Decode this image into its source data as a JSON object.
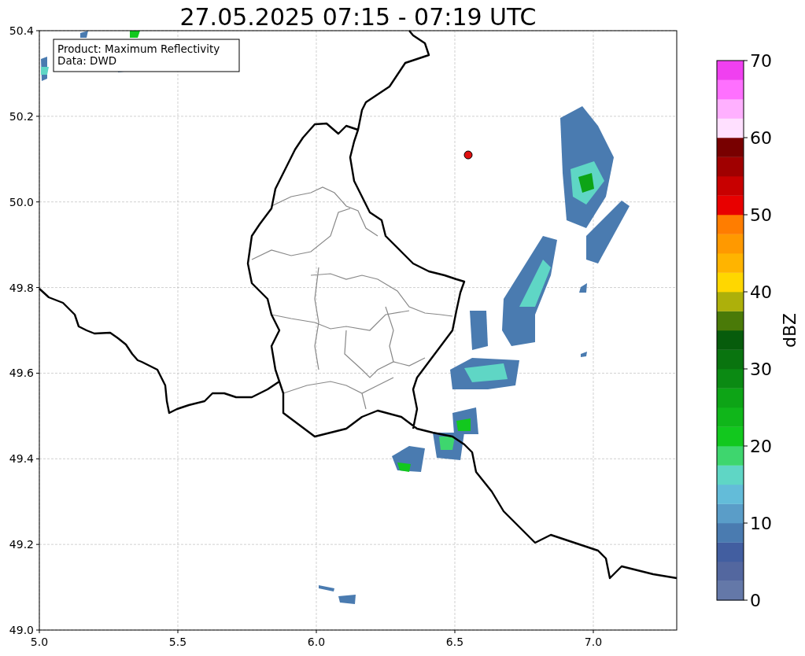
{
  "title": "27.05.2025 07:15 - 07:19 UTC",
  "info_box": {
    "lines": [
      "Product: Maximum Reflectivity",
      "Data: DWD"
    ]
  },
  "map": {
    "x_ticks": [
      "5.0",
      "5.5",
      "6.0",
      "6.5",
      "7.0"
    ],
    "y_ticks": [
      "50.4",
      "50.2",
      "50.0",
      "49.8",
      "49.6",
      "49.4",
      "49.2",
      "49.0"
    ]
  },
  "colorbar": {
    "label": "dBZ",
    "ticks": [
      "70",
      "60",
      "50",
      "40",
      "30",
      "20",
      "10",
      "0"
    ],
    "segments": [
      {
        "color": "#6478a8"
      },
      {
        "color": "#53679f"
      },
      {
        "color": "#425ea0"
      },
      {
        "color": "#4a7bb0"
      },
      {
        "color": "#5a9dc8"
      },
      {
        "color": "#63bcd9"
      },
      {
        "color": "#5fd6c5"
      },
      {
        "color": "#3ed66e"
      },
      {
        "color": "#12c81e"
      },
      {
        "color": "#10b61a"
      },
      {
        "color": "#0da416"
      },
      {
        "color": "#0b8a13"
      },
      {
        "color": "#09740f"
      },
      {
        "color": "#075c0c"
      },
      {
        "color": "#4a7a08"
      },
      {
        "color": "#adb00a"
      },
      {
        "color": "#ffd700"
      },
      {
        "color": "#ffb400"
      },
      {
        "color": "#ff9900"
      },
      {
        "color": "#ff7d00"
      },
      {
        "color": "#e80000"
      },
      {
        "color": "#c80000"
      },
      {
        "color": "#a00000"
      },
      {
        "color": "#780000"
      },
      {
        "color": "#ffe0ff"
      },
      {
        "color": "#ffb0ff"
      },
      {
        "color": "#ff70ff"
      },
      {
        "color": "#f040f0"
      }
    ]
  }
}
